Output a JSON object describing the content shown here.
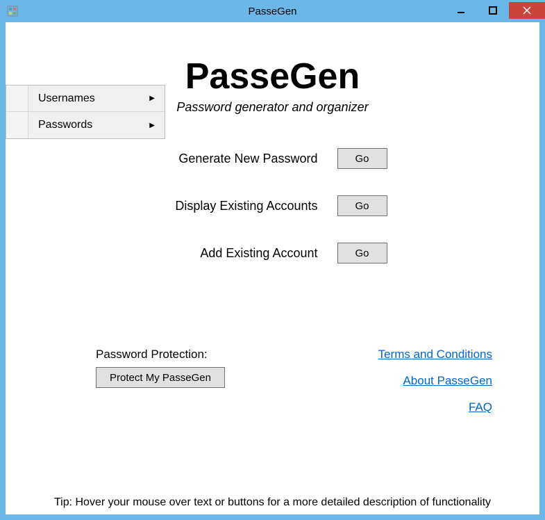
{
  "window": {
    "title": "PasseGen"
  },
  "menu": {
    "items": [
      {
        "label": "Usernames"
      },
      {
        "label": "Passwords"
      }
    ]
  },
  "hero": {
    "title": "PasseGen",
    "subtitle": "Password generator and organizer"
  },
  "actions": [
    {
      "label": "Generate New Password",
      "button": "Go"
    },
    {
      "label": "Display Existing Accounts",
      "button": "Go"
    },
    {
      "label": "Add Existing Account",
      "button": "Go"
    }
  ],
  "protection": {
    "label": "Password Protection:",
    "button": "Protect My PasseGen"
  },
  "links": {
    "terms": "Terms and Conditions",
    "about": "About PasseGen",
    "faq": "FAQ"
  },
  "tip": "Tip: Hover your mouse over text or buttons for a more detailed description of functionality"
}
